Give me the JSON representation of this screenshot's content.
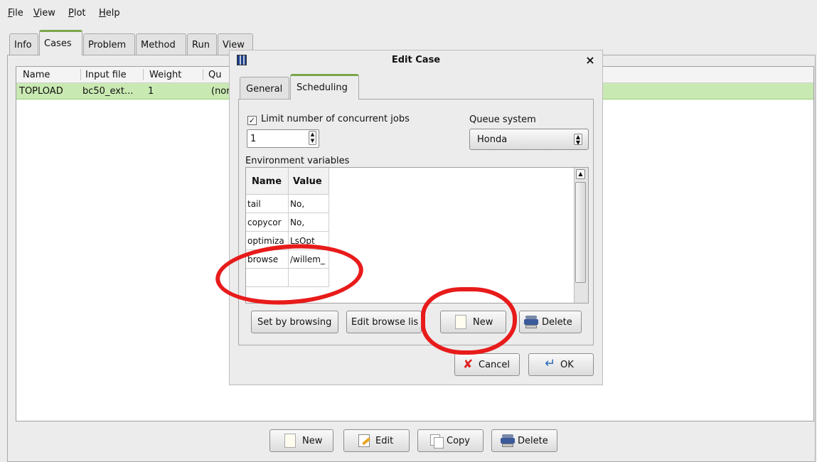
{
  "menubar": {
    "file": "File",
    "view": "View",
    "plot": "Plot",
    "help": "Help"
  },
  "main_tabs": [
    "Info",
    "Cases",
    "Problem",
    "Method",
    "Run",
    "View"
  ],
  "cases_table": {
    "headers": [
      "Name",
      "Input file",
      "Weight",
      "Qu"
    ],
    "row": {
      "name": "TOPLOAD",
      "input_file": "bc50_ext...",
      "weight": "1",
      "queue": "(nor"
    }
  },
  "bottom_buttons": {
    "new": "New",
    "edit": "Edit",
    "copy": "Copy",
    "delete": "Delete"
  },
  "dialog": {
    "title": "Edit Case",
    "close": "×",
    "tabs": [
      "General",
      "Scheduling"
    ],
    "limit_label": "Limit number of concurrent jobs",
    "limit_checked": true,
    "check_mark": "✓",
    "concurrent_value": "1",
    "queue_label": "Queue system",
    "queue_value": "Honda",
    "env_label": "Environment variables",
    "env_headers": {
      "name": "Name",
      "value": "Value"
    },
    "env_rows": [
      {
        "name": "tail",
        "value": "No,"
      },
      {
        "name": "copycor",
        "value": "No,"
      },
      {
        "name": "optimiza",
        "value": "LsOpt"
      },
      {
        "name": "browse",
        "value": "/willem_"
      },
      {
        "name": "",
        "value": ""
      }
    ],
    "buttons": {
      "set_by_browsing": "Set by browsing",
      "edit_browse_list": "Edit browse lis",
      "new": "New",
      "delete": "Delete",
      "cancel": "Cancel",
      "ok": "OK"
    }
  },
  "colors": {
    "selected_row": "#c9e9b2",
    "tab_accent": "#7aa64a",
    "annotation": "#e81b1b"
  }
}
